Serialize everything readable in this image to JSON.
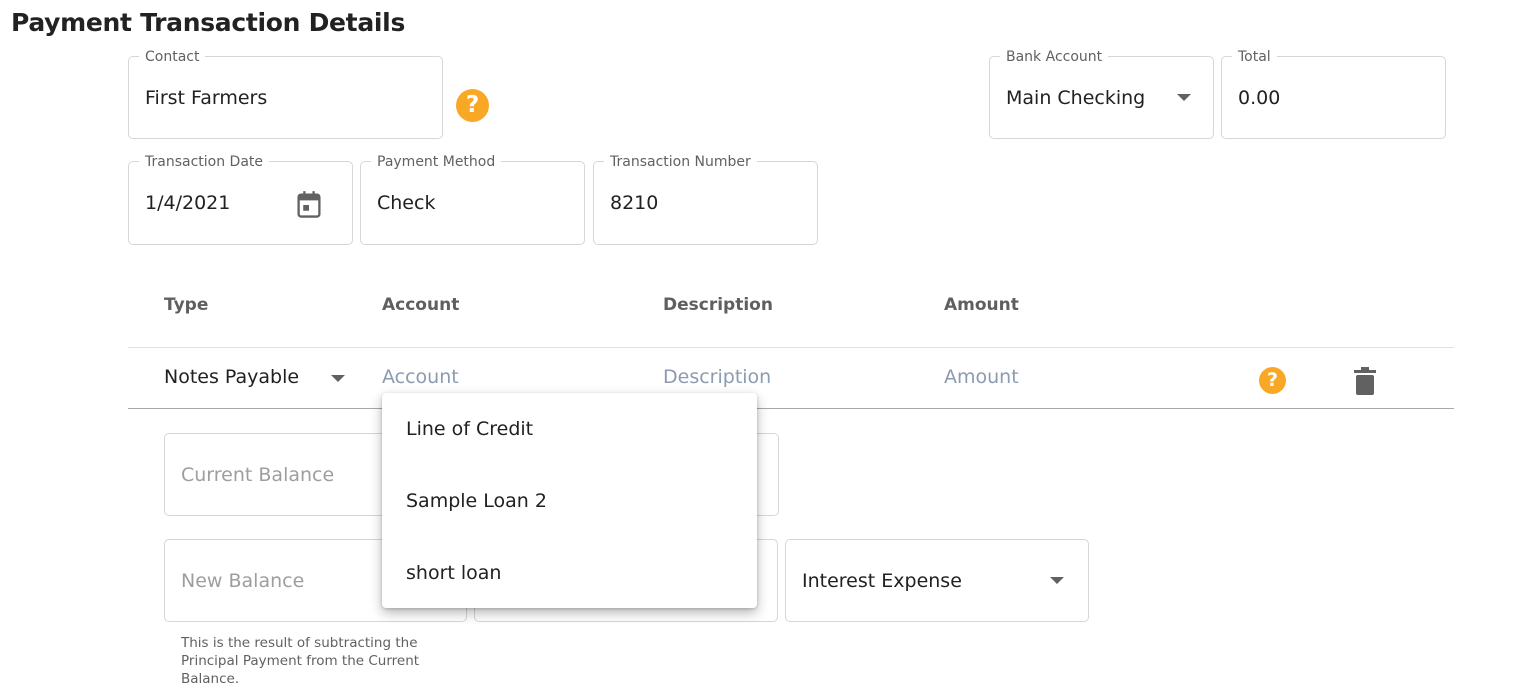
{
  "page": {
    "title": "Payment Transaction Details"
  },
  "header_fields": {
    "contact": {
      "label": "Contact",
      "value": "First Farmers"
    },
    "bank_account": {
      "label": "Bank Account",
      "value": "Main Checking"
    },
    "total": {
      "label": "Total",
      "value": "0.00"
    },
    "transaction_date": {
      "label": "Transaction Date",
      "value": "1/4/2021"
    },
    "payment_method": {
      "label": "Payment Method",
      "value": "Check"
    },
    "transaction_number": {
      "label": "Transaction Number",
      "value": "8210"
    }
  },
  "table": {
    "headers": {
      "type": "Type",
      "account": "Account",
      "description": "Description",
      "amount": "Amount"
    },
    "row": {
      "type": "Notes Payable",
      "account_placeholder": "Account",
      "description_placeholder": "Description",
      "amount_placeholder": "Amount"
    }
  },
  "account_dropdown": {
    "options": [
      "Line of Credit",
      "Sample Loan 2",
      "short loan"
    ]
  },
  "loan_fields": {
    "current_balance_placeholder": "Current Balance",
    "new_balance_placeholder": "New Balance",
    "interest_account_value": "Interest Expense",
    "new_balance_helper": "This is the result of subtracting the Principal Payment from the Current Balance."
  },
  "icons": {
    "help": "help-circle-icon",
    "calendar": "calendar-icon",
    "delete": "trash-icon",
    "dropdown": "caret-down-icon"
  },
  "colors": {
    "help_icon": "#f9a825",
    "placeholder": "#8c9bb0",
    "border": "#d6d6d6"
  }
}
